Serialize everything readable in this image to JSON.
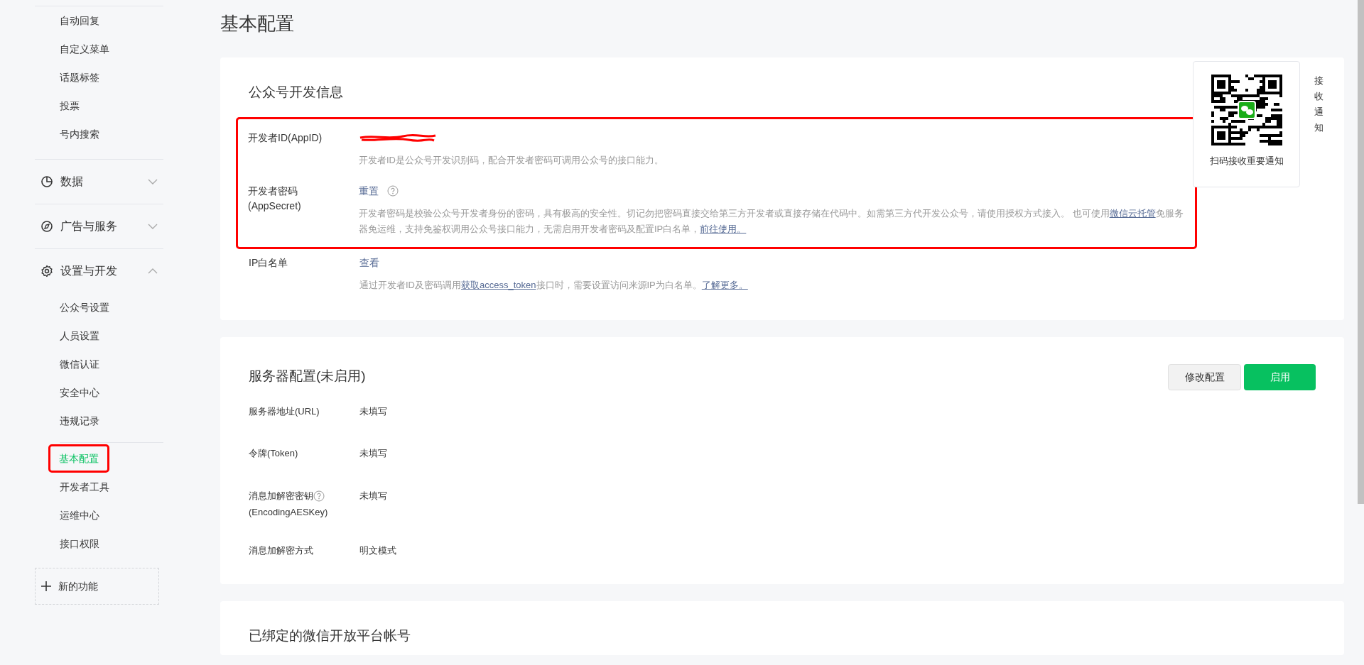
{
  "sidebar": {
    "top_items": [
      {
        "label": "自动回复",
        "selected": false,
        "highlighted": false
      },
      {
        "label": "自定义菜单",
        "selected": false,
        "highlighted": false
      },
      {
        "label": "话题标签",
        "selected": false,
        "highlighted": false
      },
      {
        "label": "投票",
        "selected": false,
        "highlighted": false
      },
      {
        "label": "号内搜索",
        "selected": false,
        "highlighted": false
      }
    ],
    "sections": [
      {
        "label": "数据",
        "expanded": false
      },
      {
        "label": "广告与服务",
        "expanded": false
      },
      {
        "label": "设置与开发",
        "expanded": true,
        "groups": [
          [
            {
              "label": "公众号设置",
              "selected": false,
              "highlighted": false
            },
            {
              "label": "人员设置",
              "selected": false,
              "highlighted": false
            },
            {
              "label": "微信认证",
              "selected": false,
              "highlighted": false
            },
            {
              "label": "安全中心",
              "selected": false,
              "highlighted": false
            },
            {
              "label": "违规记录",
              "selected": false,
              "highlighted": false
            }
          ],
          [
            {
              "label": "基本配置",
              "selected": true,
              "highlighted": true
            },
            {
              "label": "开发者工具",
              "selected": false,
              "highlighted": false
            },
            {
              "label": "运维中心",
              "selected": false,
              "highlighted": false
            },
            {
              "label": "接口权限",
              "selected": false,
              "highlighted": false
            }
          ]
        ]
      }
    ],
    "new_feature": "新的功能"
  },
  "page_title": "基本配置",
  "dev_info": {
    "title": "公众号开发信息",
    "highlighted": true,
    "rows": [
      {
        "kind": "redacted",
        "label": "开发者ID(AppID)",
        "desc": "开发者ID是公众号开发识别码，配合开发者密码可调用公众号的接口能力。"
      },
      {
        "kind": "secret",
        "label": "开发者密码(AppSecret)",
        "action": "重置",
        "desc": [
          "开发者密码是校验公众号开发者身份的密码，具有极高的安全性。切记勿把密码直接交给第三方开发者或直接存储在代码中。如需第三方代开发公众号，请使用授权方式接入。 也可使用",
          {
            "link": "微信云托管"
          },
          "免服务器免运维，支持免鉴权调用公众号接口能力，无需启用开发者密码及配置IP白名单，",
          {
            "link": "前往使用。"
          }
        ]
      },
      {
        "kind": "ip",
        "label": "IP白名单",
        "action": "查看",
        "desc": [
          "通过开发者ID及密码调用",
          {
            "link": "获取access_token"
          },
          "接口时，需要设置访问来源IP为白名单。",
          {
            "link": "了解更多。"
          }
        ]
      }
    ]
  },
  "qr_popup": {
    "caption": "扫码接收重要通知"
  },
  "side_tab": "接收通知",
  "server_config": {
    "title": "服务器配置(未启用)",
    "buttons": [
      {
        "label": "修改配置",
        "kind": "default"
      },
      {
        "label": "启用",
        "kind": "primary"
      }
    ],
    "rows": [
      {
        "label": "服务器地址(URL)",
        "value": "未填写",
        "help": false
      },
      {
        "label": "令牌(Token)",
        "value": "未填写",
        "help": false
      },
      {
        "label": "消息加解密密钥",
        "label2": "(EncodingAESKey)",
        "value": "未填写",
        "help": true
      },
      {
        "label": "消息加解密方式",
        "value": "明文模式",
        "help": false
      }
    ]
  },
  "bound_accounts": {
    "title": "已绑定的微信开放平台帐号"
  }
}
